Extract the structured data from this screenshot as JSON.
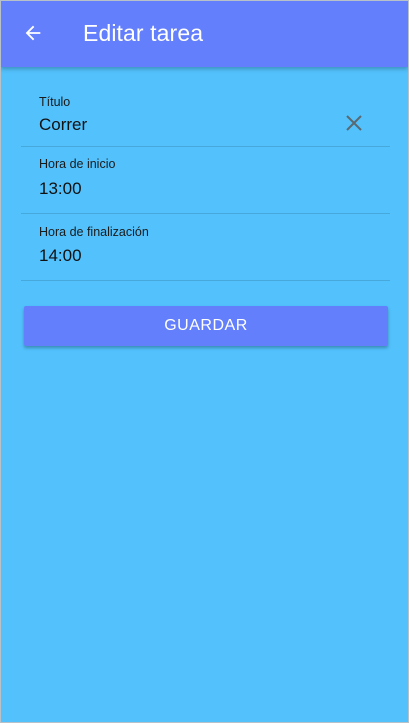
{
  "appbar": {
    "title": "Editar tarea",
    "back_icon": "arrow-left-icon"
  },
  "form": {
    "fields": [
      {
        "label": "Título",
        "value": "Correr",
        "action_icon": "close-icon"
      },
      {
        "label": "Hora de inicio",
        "value": "13:00"
      },
      {
        "label": "Hora de finalización",
        "value": "14:00"
      }
    ],
    "save_label": "GUARDAR"
  },
  "colors": {
    "background": "#52c1fc",
    "primary": "#647ffc",
    "on_primary": "#ffffff",
    "text": "#111111",
    "icon": "#5a6870"
  }
}
